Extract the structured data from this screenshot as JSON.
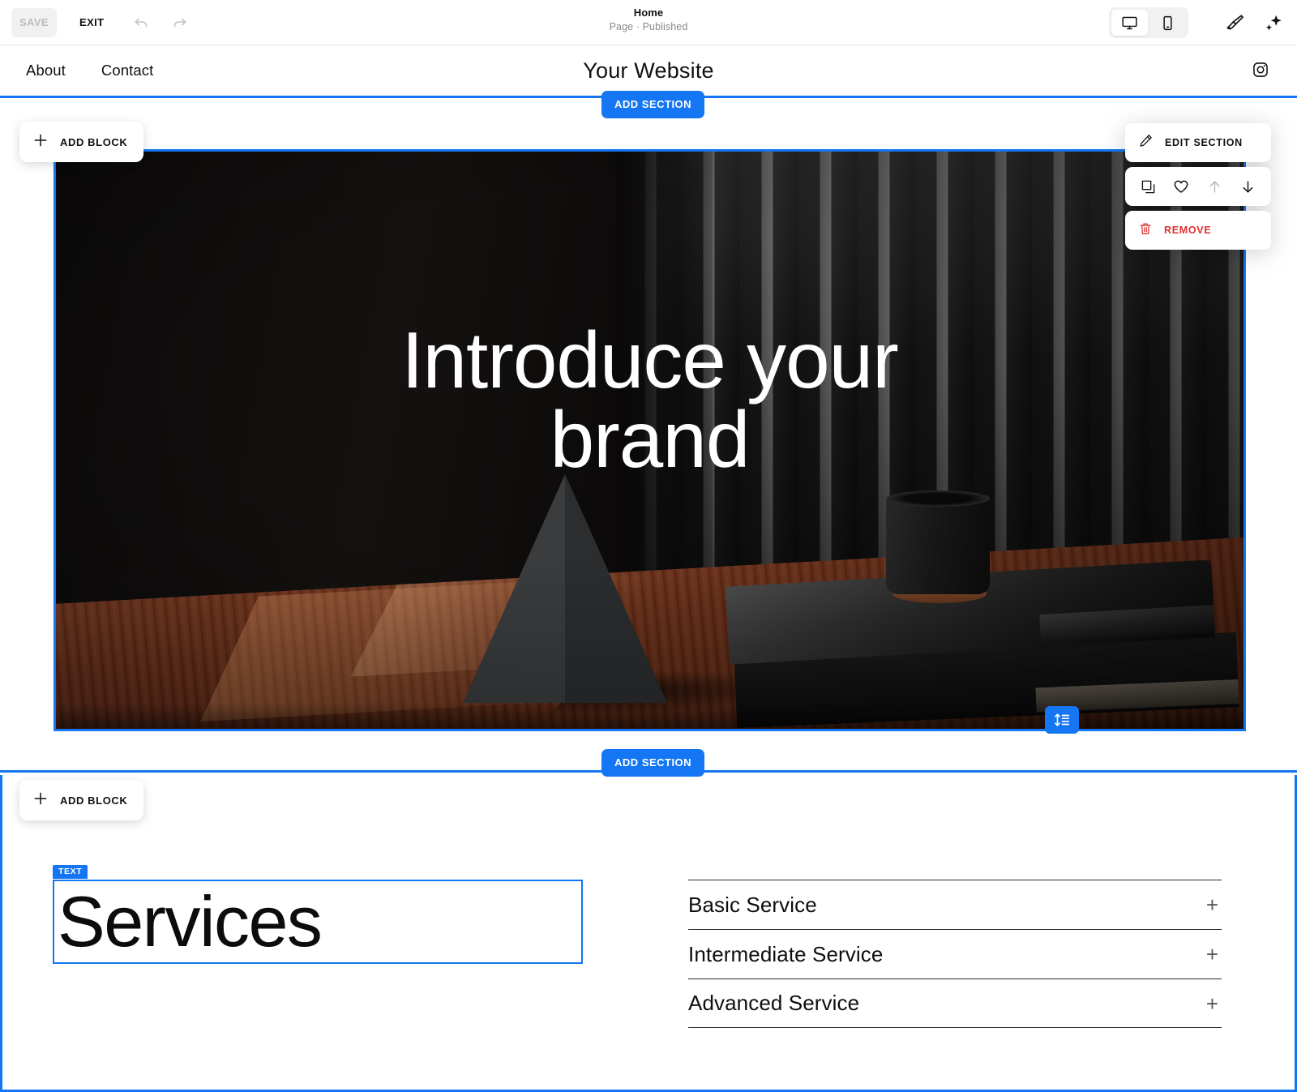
{
  "theme": {
    "accent": "#1476f2",
    "danger": "#e03030",
    "canvas_bg": "#ffffff"
  },
  "editor_bar": {
    "save_label": "SAVE",
    "exit_label": "EXIT",
    "undo_name": "undo-icon",
    "redo_name": "redo-icon",
    "page": {
      "title": "Home",
      "status": "Page · Published"
    },
    "device_switch": {
      "options": [
        {
          "label": "desktop",
          "icon": "desktop-icon",
          "active": true
        },
        {
          "label": "mobile",
          "icon": "mobile-icon",
          "active": false
        }
      ]
    },
    "tools": [
      {
        "icon": "paintbrush-icon",
        "label": "Design"
      },
      {
        "icon": "sparkle-icon",
        "label": "AI assist"
      }
    ]
  },
  "site_header": {
    "nav": [
      {
        "label": "About"
      },
      {
        "label": "Contact"
      }
    ],
    "logo": "Your Website",
    "social": {
      "icon": "instagram-icon",
      "label": "Instagram"
    }
  },
  "overlay": {
    "add_section_label": "ADD SECTION",
    "add_block_label": "ADD BLOCK",
    "section_tools": {
      "edit_label": "EDIT SECTION",
      "edit_icon": "pencil-icon",
      "remove_label": "REMOVE",
      "remove_icon": "trash-icon",
      "icons": [
        {
          "name": "duplicate-icon",
          "enabled": true
        },
        {
          "name": "heart-icon",
          "enabled": true
        },
        {
          "name": "arrow-up-icon",
          "enabled": false
        },
        {
          "name": "arrow-down-icon",
          "enabled": true
        }
      ]
    },
    "resize_handle_icon": "adjust-height-icon",
    "text_block_badge": "TEXT"
  },
  "hero": {
    "title": "Introduce your\nbrand",
    "image_alt": "dark-studio-still-life"
  },
  "services": {
    "heading": "Services",
    "items": [
      {
        "label": "Basic Service",
        "expander": "+"
      },
      {
        "label": "Intermediate Service",
        "expander": "+"
      },
      {
        "label": "Advanced Service",
        "expander": "+"
      }
    ]
  }
}
